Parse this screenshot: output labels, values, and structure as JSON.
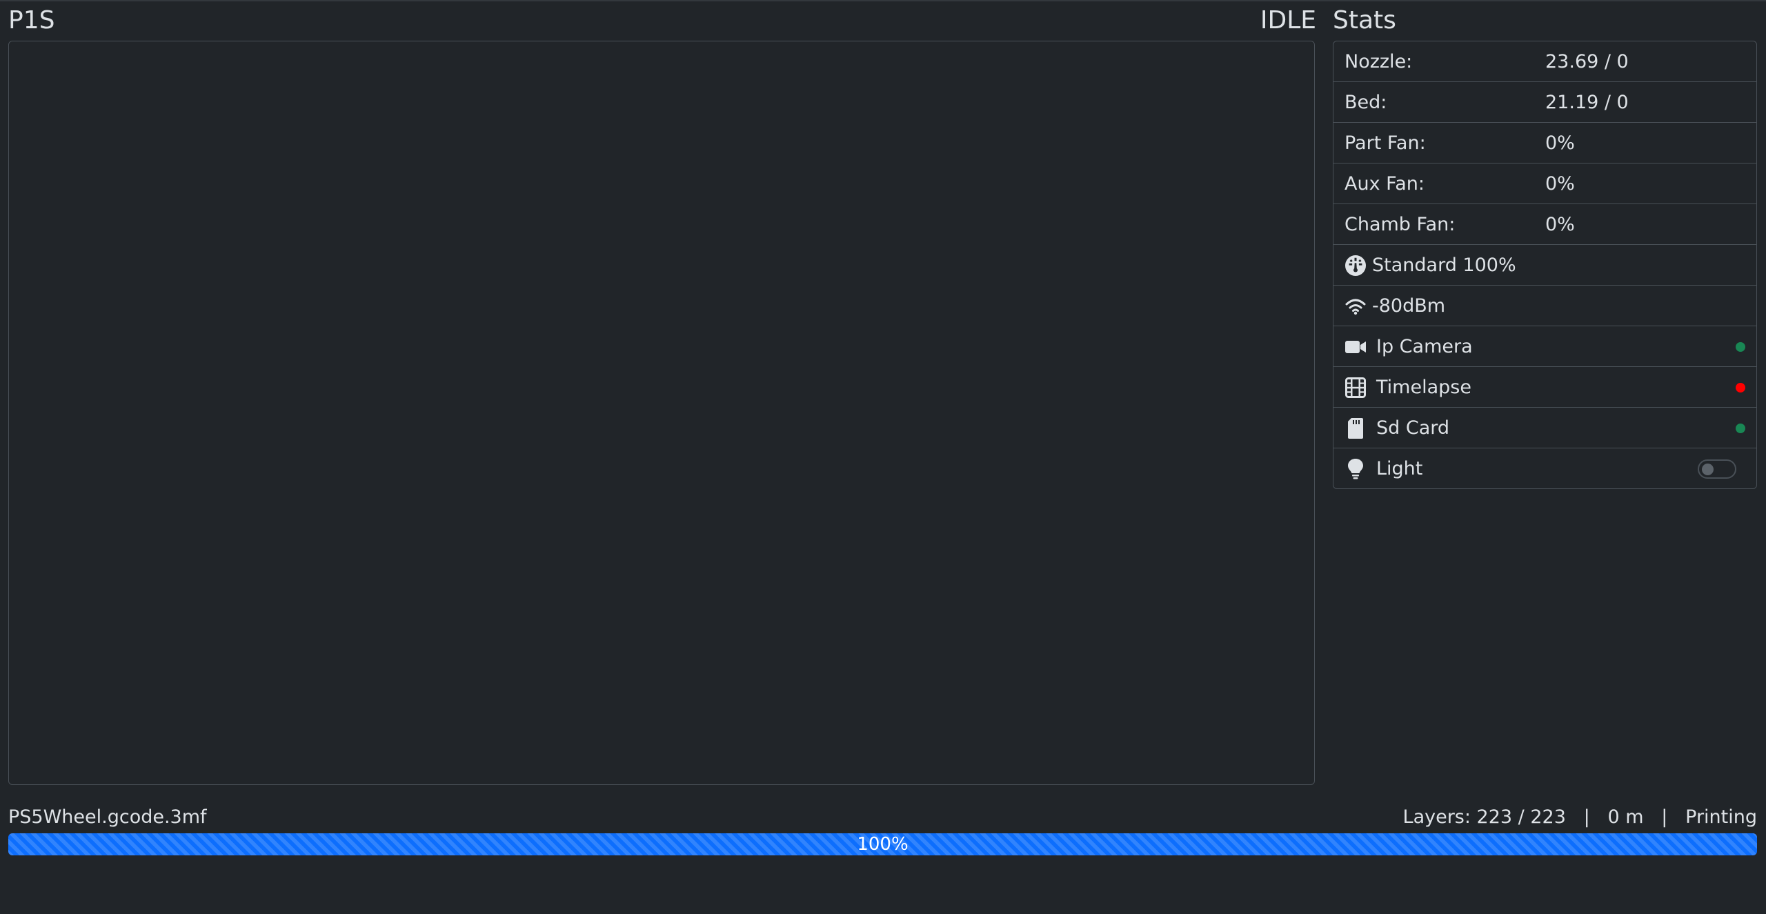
{
  "printer": {
    "name": "P1S",
    "state": "IDLE"
  },
  "stats": {
    "title": "Stats",
    "nozzle": {
      "label": "Nozzle:",
      "value": "23.69 / 0"
    },
    "bed": {
      "label": "Bed:",
      "value": "21.19 / 0"
    },
    "part_fan": {
      "label": "Part Fan:",
      "value": "0%"
    },
    "aux_fan": {
      "label": "Aux Fan:",
      "value": "0%"
    },
    "chamb_fan": {
      "label": "Chamb Fan:",
      "value": "0%"
    },
    "speed": {
      "label": "Standard 100%",
      "icon": "speedometer-icon"
    },
    "wifi": {
      "label": "-80dBm",
      "icon": "wifi-icon"
    },
    "ip_camera": {
      "label": "Ip Camera",
      "icon": "camera-icon",
      "status_color": "#198754"
    },
    "timelapse": {
      "label": "Timelapse",
      "icon": "film-icon",
      "status_color": "#ff0000"
    },
    "sd_card": {
      "label": "Sd Card",
      "icon": "sd-card-icon",
      "status_color": "#198754"
    },
    "light": {
      "label": "Light",
      "icon": "lightbulb-icon",
      "on": false
    }
  },
  "job": {
    "file": "PS5Wheel.gcode.3mf",
    "info": "Layers: 223 / 223   |   0 m   |   Printing",
    "progress_label": "100%",
    "progress_percent": 100
  },
  "colors": {
    "background": "#212529",
    "border": "#495057",
    "progress": "#0d6efd"
  }
}
